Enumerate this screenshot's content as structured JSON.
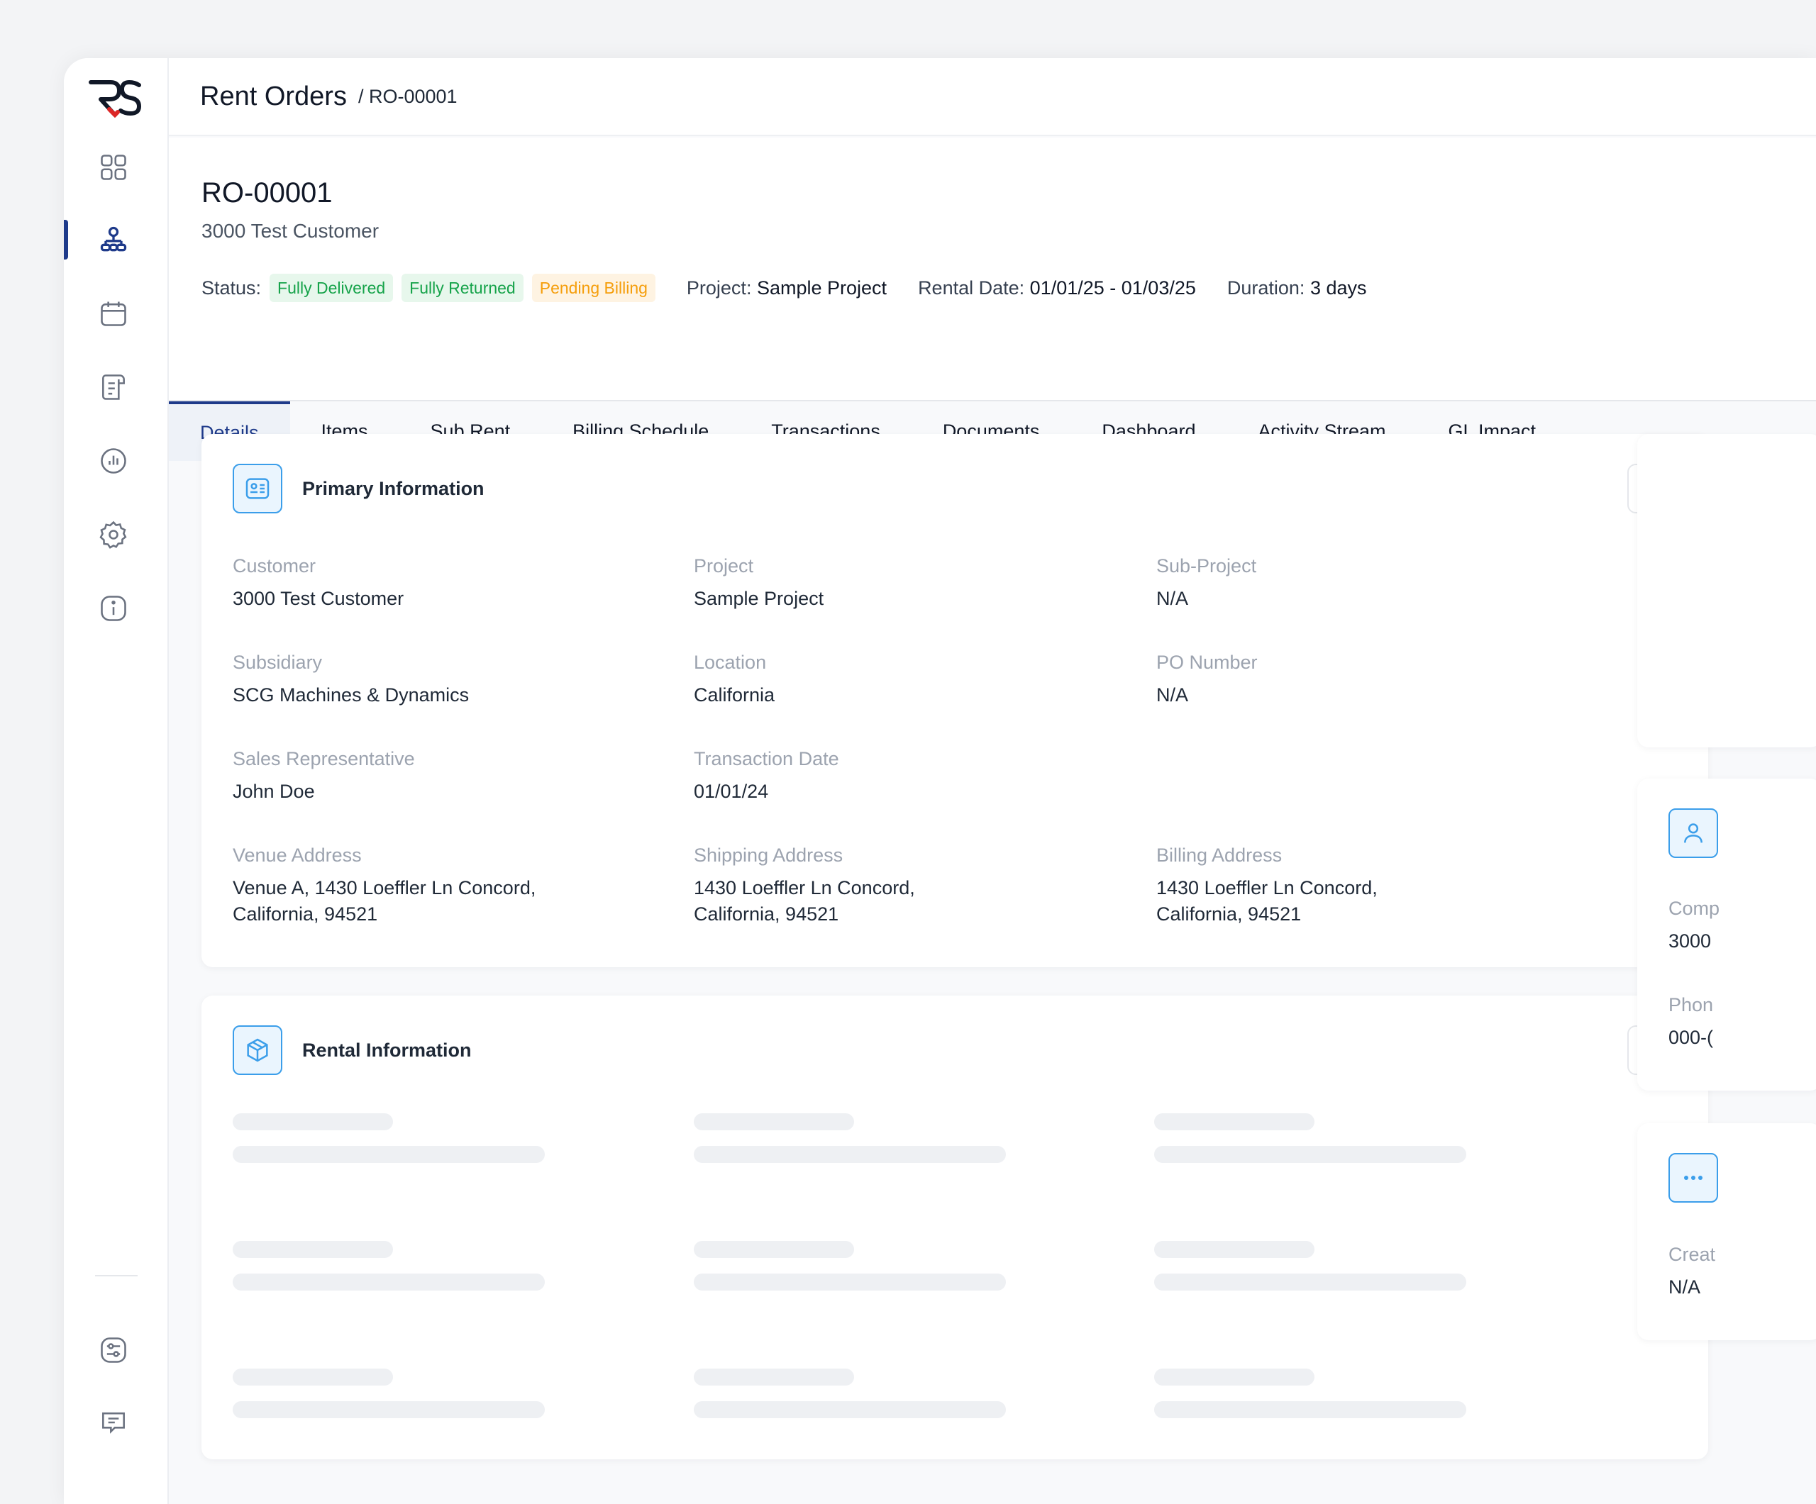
{
  "header": {
    "title": "Rent Orders",
    "breadcrumb": "/ RO-00001"
  },
  "order": {
    "id": "RO-00001",
    "customer": "3000 Test Customer",
    "status_label": "Status:",
    "badges": [
      "Fully Delivered",
      "Fully Returned",
      "Pending Billing"
    ],
    "project_label": "Project:",
    "project_value": "Sample Project",
    "rental_date_label": "Rental Date:",
    "rental_date_value": "01/01/25 - 01/03/25",
    "duration_label": "Duration:",
    "duration_value": "3 days"
  },
  "tabs": [
    "Details",
    "Items",
    "Sub Rent",
    "Billing Schedule",
    "Transactions",
    "Documents",
    "Dashboard",
    "Activity Stream",
    "GL Impact"
  ],
  "primary": {
    "title": "Primary Information",
    "fields": [
      {
        "label": "Customer",
        "value": "3000 Test Customer"
      },
      {
        "label": "Project",
        "value": "Sample Project"
      },
      {
        "label": "Sub-Project",
        "value": "N/A"
      },
      {
        "label": "Subsidiary",
        "value": "SCG Machines & Dynamics"
      },
      {
        "label": "Location",
        "value": "California"
      },
      {
        "label": "PO Number",
        "value": "N/A"
      },
      {
        "label": "Sales Representative",
        "value": "John Doe"
      },
      {
        "label": "Transaction Date",
        "value": "01/01/24"
      },
      {
        "label": "Venue Address",
        "value_line1": "Venue A, 1430 Loeffler Ln Concord,",
        "value_line2": "California, 94521"
      },
      {
        "label": "Shipping Address",
        "value_line1": "1430 Loeffler Ln Concord,",
        "value_line2": "California, 94521"
      },
      {
        "label": "Billing Address",
        "value_line1": "1430 Loeffler Ln Concord,",
        "value_line2": "California, 94521"
      }
    ]
  },
  "rental": {
    "title": "Rental Information"
  },
  "right_panel": {
    "contact": {
      "label1": "Comp",
      "value1": "3000",
      "label2": "Phon",
      "value2": "000-("
    },
    "other": {
      "label1": "Creat",
      "value1": "N/A"
    }
  },
  "icons": {
    "nav": [
      "grid-icon",
      "org-chart-icon",
      "calendar-icon",
      "receipt-icon",
      "bar-chart-icon",
      "gear-icon",
      "info-icon",
      "sliders-icon",
      "chat-icon"
    ],
    "accent": "#3b9eea",
    "active": "#1e3a8a"
  }
}
